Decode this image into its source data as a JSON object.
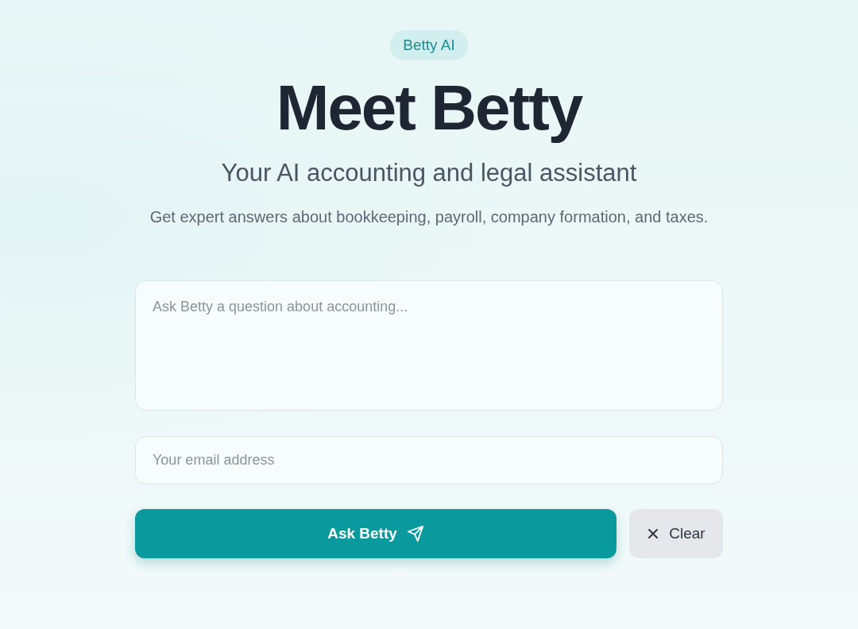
{
  "badge": "Betty AI",
  "title": "Meet Betty",
  "subtitle": "Your AI accounting and legal assistant",
  "description": "Get expert answers about bookkeeping, payroll, company formation, and taxes.",
  "question_field": {
    "placeholder": "Ask Betty a question about accounting..."
  },
  "email_field": {
    "placeholder": "Your email address"
  },
  "buttons": [
    {
      "kind": "primary",
      "label": "Ask Betty"
    },
    {
      "kind": "secondary",
      "label": "Clear"
    }
  ]
}
